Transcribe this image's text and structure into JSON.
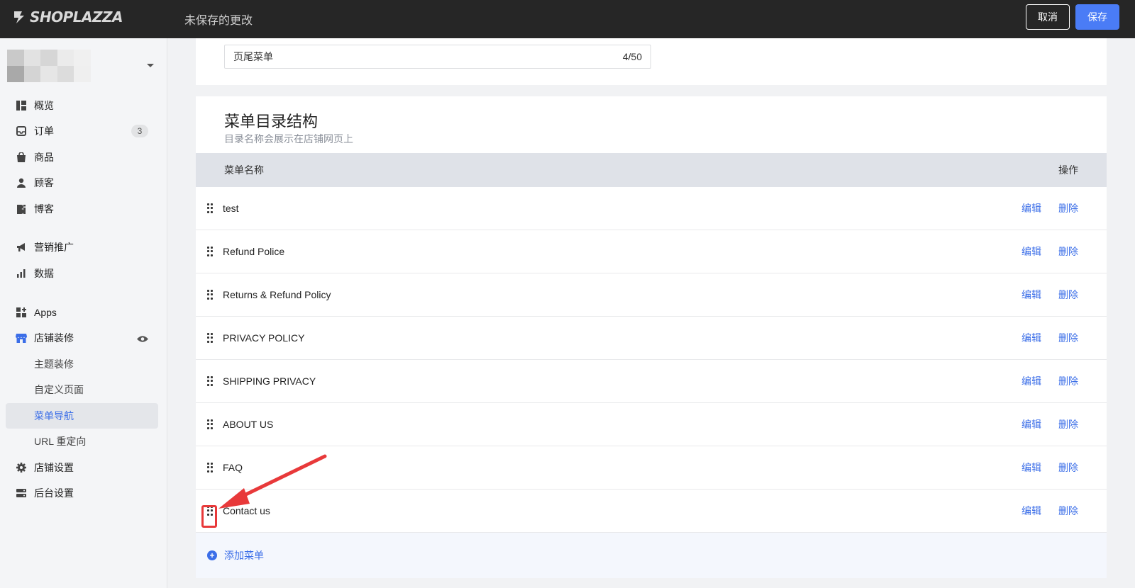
{
  "topbar": {
    "logo_text": "SHOPLAZZA",
    "unsaved_text": "未保存的更改",
    "cancel_label": "取消",
    "save_label": "保存"
  },
  "sidebar": {
    "items": [
      {
        "label": "概览",
        "icon": "dashboard-icon"
      },
      {
        "label": "订单",
        "icon": "inbox-icon",
        "badge": "3"
      },
      {
        "label": "商品",
        "icon": "bag-icon"
      },
      {
        "label": "顾客",
        "icon": "person-icon"
      },
      {
        "label": "博客",
        "icon": "blog-icon"
      },
      {
        "label": "营销推广",
        "icon": "megaphone-icon"
      },
      {
        "label": "数据",
        "icon": "bar-chart-icon"
      },
      {
        "label": "Apps",
        "icon": "apps-icon"
      },
      {
        "label": "店铺装修",
        "icon": "storefront-icon"
      },
      {
        "label": "主题装修"
      },
      {
        "label": "自定义页面"
      },
      {
        "label": "菜单导航"
      },
      {
        "label": "URL 重定向"
      },
      {
        "label": "店铺设置",
        "icon": "gear-icon"
      },
      {
        "label": "后台设置",
        "icon": "server-icon"
      }
    ]
  },
  "name_card": {
    "input_value": "页尾菜单",
    "counter": "4/50"
  },
  "menu_card": {
    "title": "菜单目录结构",
    "subtitle": "目录名称会展示在店铺网页上",
    "col_name": "菜单名称",
    "col_op": "操作",
    "edit_label": "编辑",
    "delete_label": "删除",
    "rows": [
      "test",
      "Refund Police",
      "Returns & Refund Policy",
      "PRIVACY POLICY",
      "SHIPPING PRIVACY",
      "ABOUT US",
      "FAQ",
      "Contact us"
    ],
    "add_label": "添加菜单"
  },
  "colors": {
    "accent": "#3b6ee8",
    "save_button": "#4a7cf6",
    "annotation": "#e8393a",
    "topbar": "#262626"
  }
}
